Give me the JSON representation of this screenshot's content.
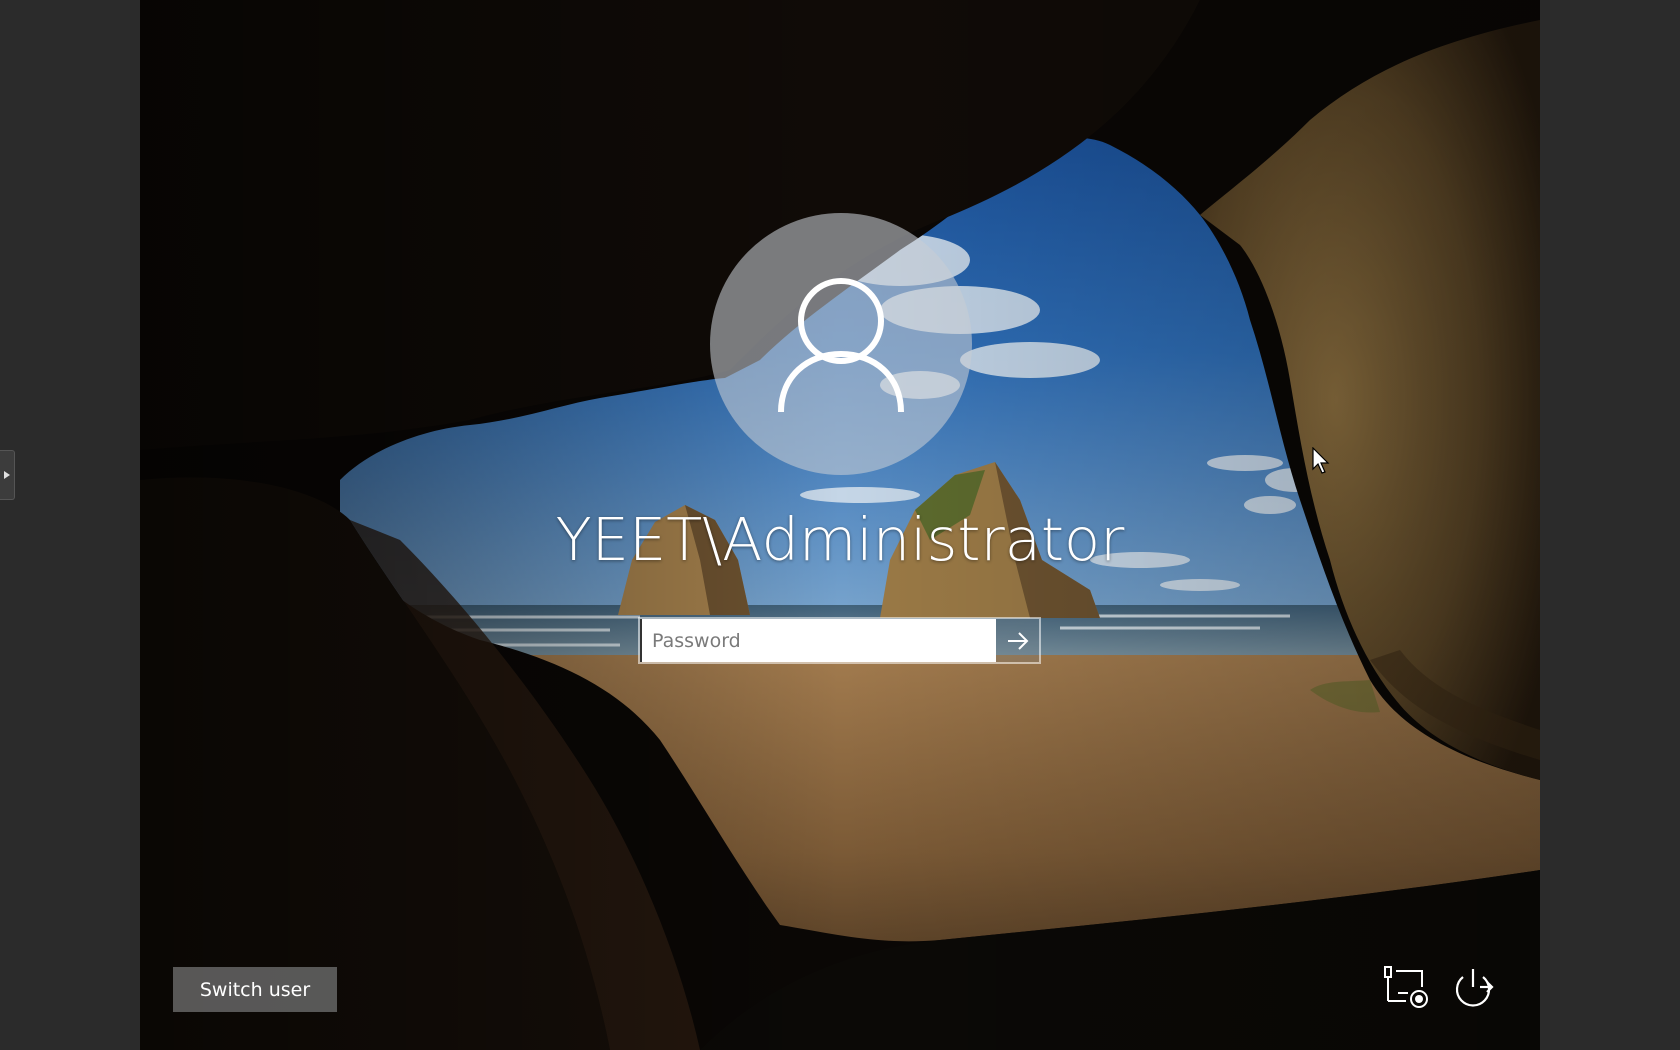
{
  "login": {
    "username": "YEET\\Administrator",
    "password_placeholder": "Password",
    "password_value": ""
  },
  "actions": {
    "switch_user_label": "Switch user"
  },
  "icons": {
    "user": "user-avatar-icon",
    "submit": "arrow-right-icon",
    "network": "network-icon",
    "power": "power-icon",
    "side_panel": "chevron-right-icon"
  },
  "colors": {
    "outer_background": "#2b2b2b",
    "text": "#ffffff",
    "switch_user_background": "#6e6e6e"
  }
}
